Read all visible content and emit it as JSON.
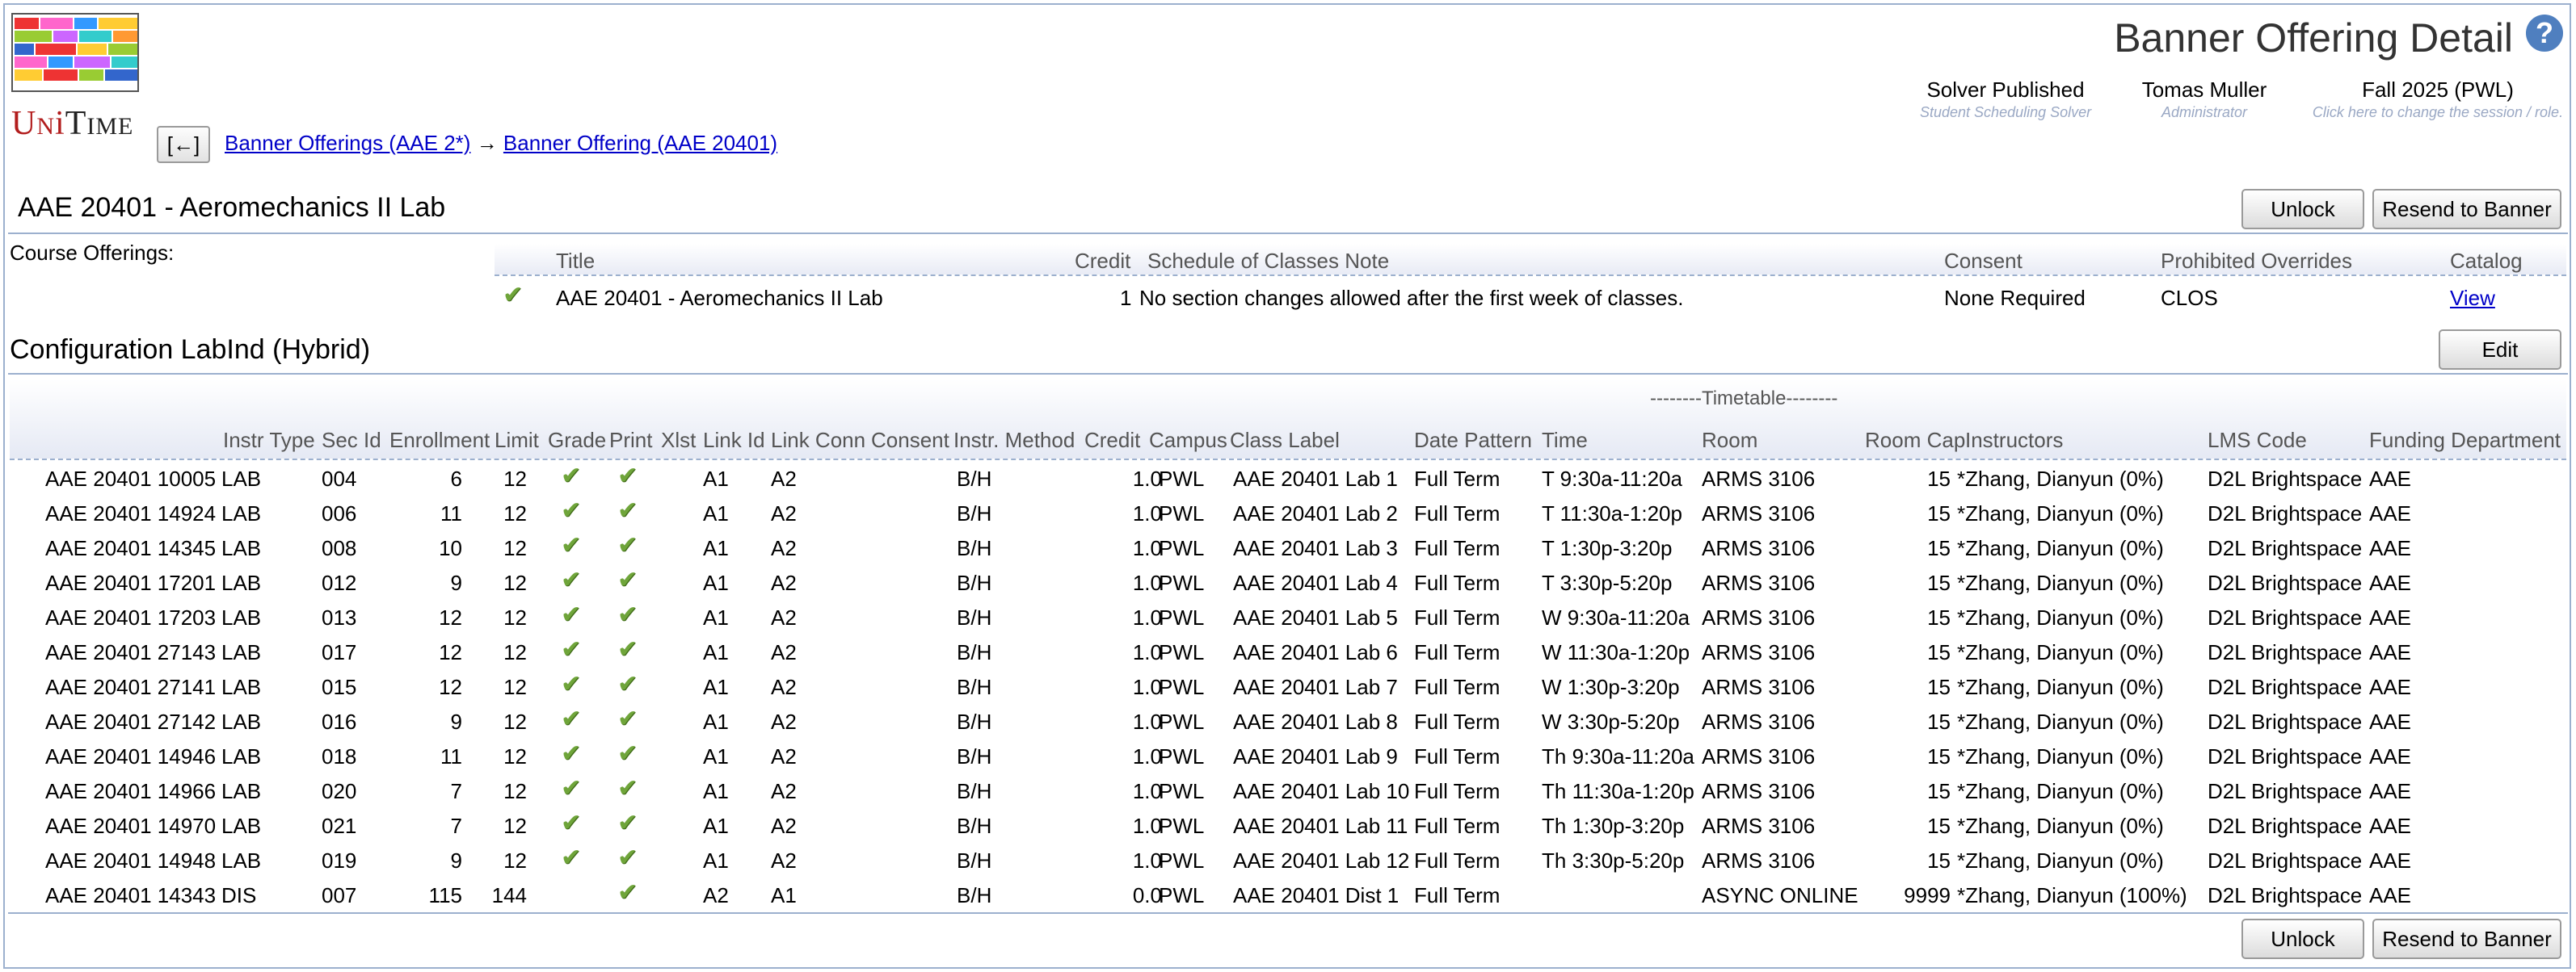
{
  "app": {
    "logo_text": "UniTime"
  },
  "header": {
    "page_title": "Banner Offering Detail",
    "help_glyph": "?",
    "solver": {
      "status": "Solver Published",
      "detail": "Student Scheduling Solver"
    },
    "user": {
      "name": "Tomas Muller",
      "role": "Administrator"
    },
    "term": {
      "name": "Fall 2025 (PWL)",
      "hint": "Click here to change the session / role."
    }
  },
  "nav": {
    "back_label": "[←]",
    "breadcrumb": [
      {
        "label": "Banner Offerings (AAE 2*)"
      },
      {
        "label": "Banner Offering (AAE 20401)"
      }
    ],
    "separator": "→"
  },
  "offering": {
    "title": "AAE 20401 - Aeromechanics II Lab",
    "unlock_label": "Unlock",
    "resend_label": "Resend to Banner"
  },
  "course_offerings": {
    "label": "Course Offerings:",
    "columns": [
      "Title",
      "Credit",
      "Schedule of Classes Note",
      "Consent",
      "Prohibited Overrides",
      "Catalog"
    ],
    "row": {
      "title": "AAE 20401 - Aeromechanics II Lab",
      "credit": "1",
      "note": "No section changes allowed after the first week of classes.",
      "consent": "None Required",
      "prohibited_overrides": "CLOS",
      "catalog": "View"
    }
  },
  "configuration": {
    "title": "Configuration LabInd (Hybrid)",
    "edit_label": "Edit",
    "timetable_label": "--------Timetable--------",
    "columns": [
      "Instr Type",
      "Sec Id",
      "Enrollment",
      "Limit",
      "Grade",
      "Print",
      "Xlst",
      "Link Id",
      "Link Conn",
      "Consent",
      "Instr. Method",
      "Credit",
      "Campus",
      "Class Label",
      "Date Pattern",
      "Time",
      "Room",
      "Room Cap",
      "Instructors",
      "LMS Code",
      "Funding Department"
    ],
    "classes": [
      {
        "name": "AAE 20401 10005",
        "itype": "LAB",
        "sec": "004",
        "enrl": "6",
        "limit": "12",
        "grade": true,
        "print": true,
        "link": "A1",
        "conn": "A2",
        "method": "B/H",
        "credit": "1.0",
        "campus": "PWL",
        "label": "AAE 20401 Lab 1",
        "date": "Full Term",
        "time": "T 9:30a-11:20a",
        "room": "ARMS 3106",
        "cap": "15",
        "instr": "*Zhang, Dianyun (0%)",
        "lms": "D2L Brightspace",
        "dept": "AAE"
      },
      {
        "name": "AAE 20401 14924",
        "itype": "LAB",
        "sec": "006",
        "enrl": "11",
        "limit": "12",
        "grade": true,
        "print": true,
        "link": "A1",
        "conn": "A2",
        "method": "B/H",
        "credit": "1.0",
        "campus": "PWL",
        "label": "AAE 20401 Lab 2",
        "date": "Full Term",
        "time": "T 11:30a-1:20p",
        "room": "ARMS 3106",
        "cap": "15",
        "instr": "*Zhang, Dianyun (0%)",
        "lms": "D2L Brightspace",
        "dept": "AAE"
      },
      {
        "name": "AAE 20401 14345",
        "itype": "LAB",
        "sec": "008",
        "enrl": "10",
        "limit": "12",
        "grade": true,
        "print": true,
        "link": "A1",
        "conn": "A2",
        "method": "B/H",
        "credit": "1.0",
        "campus": "PWL",
        "label": "AAE 20401 Lab 3",
        "date": "Full Term",
        "time": "T 1:30p-3:20p",
        "room": "ARMS 3106",
        "cap": "15",
        "instr": "*Zhang, Dianyun (0%)",
        "lms": "D2L Brightspace",
        "dept": "AAE"
      },
      {
        "name": "AAE 20401 17201",
        "itype": "LAB",
        "sec": "012",
        "enrl": "9",
        "limit": "12",
        "grade": true,
        "print": true,
        "link": "A1",
        "conn": "A2",
        "method": "B/H",
        "credit": "1.0",
        "campus": "PWL",
        "label": "AAE 20401 Lab 4",
        "date": "Full Term",
        "time": "T 3:30p-5:20p",
        "room": "ARMS 3106",
        "cap": "15",
        "instr": "*Zhang, Dianyun (0%)",
        "lms": "D2L Brightspace",
        "dept": "AAE"
      },
      {
        "name": "AAE 20401 17203",
        "itype": "LAB",
        "sec": "013",
        "enrl": "12",
        "limit": "12",
        "grade": true,
        "print": true,
        "link": "A1",
        "conn": "A2",
        "method": "B/H",
        "credit": "1.0",
        "campus": "PWL",
        "label": "AAE 20401 Lab 5",
        "date": "Full Term",
        "time": "W 9:30a-11:20a",
        "room": "ARMS 3106",
        "cap": "15",
        "instr": "*Zhang, Dianyun (0%)",
        "lms": "D2L Brightspace",
        "dept": "AAE"
      },
      {
        "name": "AAE 20401 27143",
        "itype": "LAB",
        "sec": "017",
        "enrl": "12",
        "limit": "12",
        "grade": true,
        "print": true,
        "link": "A1",
        "conn": "A2",
        "method": "B/H",
        "credit": "1.0",
        "campus": "PWL",
        "label": "AAE 20401 Lab 6",
        "date": "Full Term",
        "time": "W 11:30a-1:20p",
        "room": "ARMS 3106",
        "cap": "15",
        "instr": "*Zhang, Dianyun (0%)",
        "lms": "D2L Brightspace",
        "dept": "AAE"
      },
      {
        "name": "AAE 20401 27141",
        "itype": "LAB",
        "sec": "015",
        "enrl": "12",
        "limit": "12",
        "grade": true,
        "print": true,
        "link": "A1",
        "conn": "A2",
        "method": "B/H",
        "credit": "1.0",
        "campus": "PWL",
        "label": "AAE 20401 Lab 7",
        "date": "Full Term",
        "time": "W 1:30p-3:20p",
        "room": "ARMS 3106",
        "cap": "15",
        "instr": "*Zhang, Dianyun (0%)",
        "lms": "D2L Brightspace",
        "dept": "AAE"
      },
      {
        "name": "AAE 20401 27142",
        "itype": "LAB",
        "sec": "016",
        "enrl": "9",
        "limit": "12",
        "grade": true,
        "print": true,
        "link": "A1",
        "conn": "A2",
        "method": "B/H",
        "credit": "1.0",
        "campus": "PWL",
        "label": "AAE 20401 Lab 8",
        "date": "Full Term",
        "time": "W 3:30p-5:20p",
        "room": "ARMS 3106",
        "cap": "15",
        "instr": "*Zhang, Dianyun (0%)",
        "lms": "D2L Brightspace",
        "dept": "AAE"
      },
      {
        "name": "AAE 20401 14946",
        "itype": "LAB",
        "sec": "018",
        "enrl": "11",
        "limit": "12",
        "grade": true,
        "print": true,
        "link": "A1",
        "conn": "A2",
        "method": "B/H",
        "credit": "1.0",
        "campus": "PWL",
        "label": "AAE 20401 Lab 9",
        "date": "Full Term",
        "time": "Th 9:30a-11:20a",
        "room": "ARMS 3106",
        "cap": "15",
        "instr": "*Zhang, Dianyun (0%)",
        "lms": "D2L Brightspace",
        "dept": "AAE"
      },
      {
        "name": "AAE 20401 14966",
        "itype": "LAB",
        "sec": "020",
        "enrl": "7",
        "limit": "12",
        "grade": true,
        "print": true,
        "link": "A1",
        "conn": "A2",
        "method": "B/H",
        "credit": "1.0",
        "campus": "PWL",
        "label": "AAE 20401 Lab 10",
        "date": "Full Term",
        "time": "Th 11:30a-1:20p",
        "room": "ARMS 3106",
        "cap": "15",
        "instr": "*Zhang, Dianyun (0%)",
        "lms": "D2L Brightspace",
        "dept": "AAE"
      },
      {
        "name": "AAE 20401 14970",
        "itype": "LAB",
        "sec": "021",
        "enrl": "7",
        "limit": "12",
        "grade": true,
        "print": true,
        "link": "A1",
        "conn": "A2",
        "method": "B/H",
        "credit": "1.0",
        "campus": "PWL",
        "label": "AAE 20401 Lab 11",
        "date": "Full Term",
        "time": "Th 1:30p-3:20p",
        "room": "ARMS 3106",
        "cap": "15",
        "instr": "*Zhang, Dianyun (0%)",
        "lms": "D2L Brightspace",
        "dept": "AAE"
      },
      {
        "name": "AAE 20401 14948",
        "itype": "LAB",
        "sec": "019",
        "enrl": "9",
        "limit": "12",
        "grade": true,
        "print": true,
        "link": "A1",
        "conn": "A2",
        "method": "B/H",
        "credit": "1.0",
        "campus": "PWL",
        "label": "AAE 20401 Lab 12",
        "date": "Full Term",
        "time": "Th 3:30p-5:20p",
        "room": "ARMS 3106",
        "cap": "15",
        "instr": "*Zhang, Dianyun (0%)",
        "lms": "D2L Brightspace",
        "dept": "AAE"
      },
      {
        "name": "AAE 20401 14343",
        "itype": "DIS",
        "sec": "007",
        "enrl": "115",
        "limit": "144",
        "grade": false,
        "print": true,
        "link": "A2",
        "conn": "A1",
        "method": "B/H",
        "credit": "0.0",
        "campus": "PWL",
        "label": "AAE 20401 Dist 1",
        "date": "Full Term",
        "time": "",
        "room": "ASYNC ONLINE",
        "cap": "9999",
        "instr": "*Zhang, Dianyun (100%)",
        "lms": "D2L Brightspace",
        "dept": "AAE"
      }
    ]
  },
  "colors": {
    "border": "#9cb0ce",
    "link": "#0000c8",
    "check": "#6fa53a",
    "header_text": "#555555"
  },
  "icons": [
    "help-icon",
    "check-icon",
    "unitime-logo"
  ]
}
